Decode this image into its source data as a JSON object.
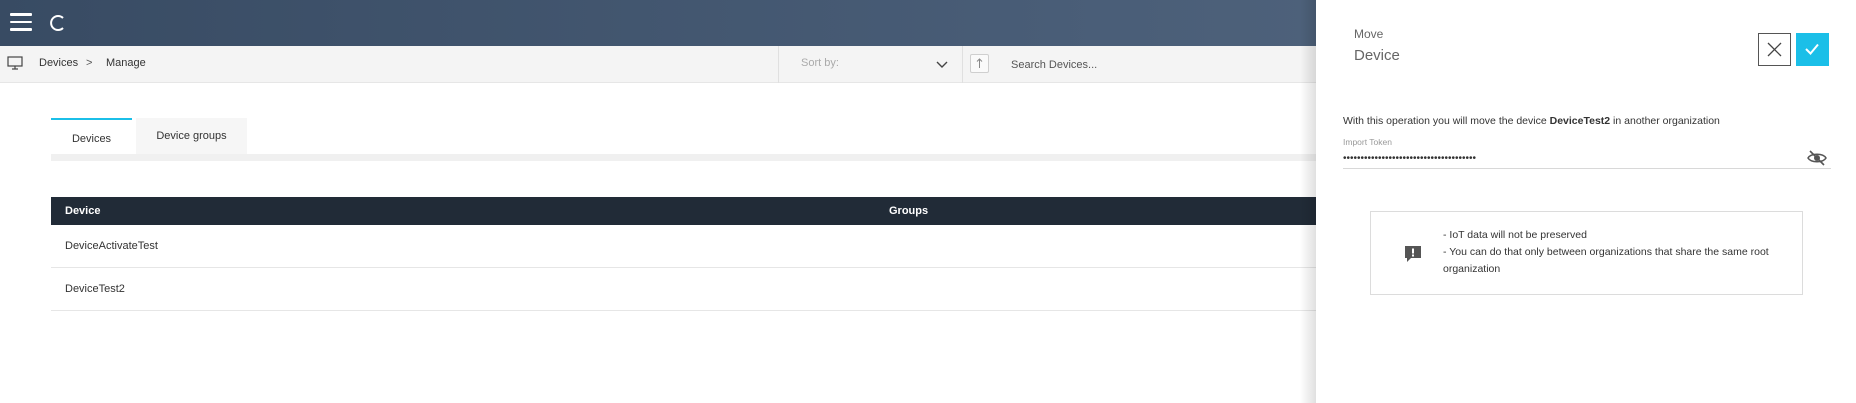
{
  "breadcrumb": {
    "section": "Devices",
    "separator": ">",
    "page": "Manage"
  },
  "toolbar": {
    "sort_label": "Sort by:",
    "search_placeholder": "Search Devices..."
  },
  "tabs": [
    {
      "label": "Devices",
      "active": true
    },
    {
      "label": "Device groups",
      "active": false
    }
  ],
  "table": {
    "columns": [
      "Device",
      "Groups"
    ],
    "rows": [
      {
        "device": "DeviceActivateTest",
        "groups": ""
      },
      {
        "device": "DeviceTest2",
        "groups": ""
      }
    ]
  },
  "panel": {
    "title_small": "Move",
    "title_big": "Device",
    "desc_prefix": "With this operation you will move the device",
    "desc_device": "DeviceTest2",
    "desc_suffix": "in another organization",
    "token_label": "Import Token",
    "token_value": "••••••••••••••••••••••••••••••••••••••",
    "notice_lines": [
      "- IoT data will not be preserved",
      "- You can do that only between organizations that share the same root organization"
    ]
  },
  "colors": {
    "header": "#384b63",
    "accent": "#1bbfe8",
    "table_header": "#212b37"
  },
  "icons": [
    "menu-icon",
    "loading-icon",
    "monitor-icon",
    "chevron-down-icon",
    "sort-arrow-icon",
    "close-icon",
    "check-icon",
    "eye-off-icon",
    "alert-icon"
  ]
}
